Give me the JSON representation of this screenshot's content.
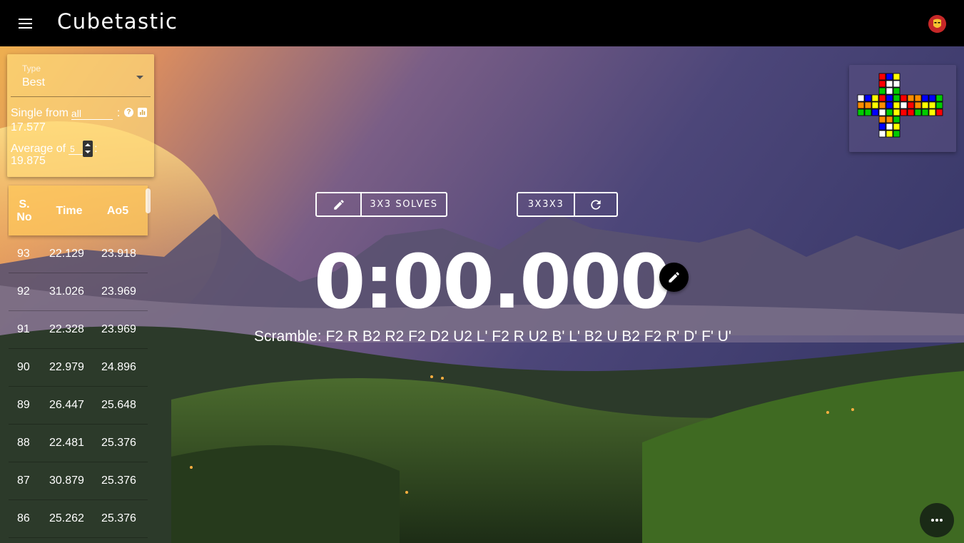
{
  "app": {
    "title": "Cubetastic"
  },
  "stats": {
    "type_label": "Type",
    "type_value": "Best",
    "single_label": "Single from",
    "single_scope": "all",
    "colon": ":",
    "single_value": "17.577",
    "avg_label": "Average of",
    "avg_count": "5",
    "avg_value": "19.875"
  },
  "table": {
    "headers": [
      "S. No",
      "Time",
      "Ao5"
    ],
    "rows": [
      {
        "sno": "93",
        "time": "22.129",
        "ao5": "23.918"
      },
      {
        "sno": "92",
        "time": "31.026",
        "ao5": "23.969"
      },
      {
        "sno": "91",
        "time": "22.328",
        "ao5": "23.969"
      },
      {
        "sno": "90",
        "time": "22.979",
        "ao5": "24.896"
      },
      {
        "sno": "89",
        "time": "26.447",
        "ao5": "25.648"
      },
      {
        "sno": "88",
        "time": "22.481",
        "ao5": "25.376"
      },
      {
        "sno": "87",
        "time": "30.879",
        "ao5": "25.376"
      },
      {
        "sno": "86",
        "time": "25.262",
        "ao5": "25.376"
      }
    ]
  },
  "controls": {
    "session_label": "3X3 SOLVES",
    "puzzle_label": "3X3X3"
  },
  "timer": {
    "display": "0:00.000"
  },
  "scramble": {
    "label": "Scramble:",
    "moves": "F2 R B2 R2 F2 D2 U2 L' F2 R U2 B' L' B2 U B2 F2 R' D' F' U'"
  },
  "cube_net": {
    "colors": {
      "W": "#ffffff",
      "Y": "#ffff00",
      "R": "#ff0000",
      "O": "#ff8c00",
      "B": "#0000ff",
      "G": "#00cc00"
    },
    "U": [
      [
        "R",
        "B",
        "Y"
      ],
      [
        "R",
        "W",
        "W"
      ],
      [
        "G",
        "W",
        "G"
      ]
    ],
    "L": [
      [
        "W",
        "B",
        "Y"
      ],
      [
        "O",
        "O",
        "Y"
      ],
      [
        "G",
        "G",
        "B"
      ]
    ],
    "F": [
      [
        "R",
        "B",
        "G"
      ],
      [
        "O",
        "B",
        "Y"
      ],
      [
        "W",
        "G",
        "Y"
      ]
    ],
    "R": [
      [
        "R",
        "O",
        "O"
      ],
      [
        "W",
        "R",
        "O"
      ],
      [
        "R",
        "R",
        "G"
      ]
    ],
    "B": [
      [
        "B",
        "B",
        "G"
      ],
      [
        "Y",
        "Y",
        "G"
      ],
      [
        "G",
        "Y",
        "R"
      ]
    ],
    "D": [
      [
        "O",
        "O",
        "G"
      ],
      [
        "B",
        "W",
        "Y"
      ],
      [
        "W",
        "Y",
        "G"
      ]
    ]
  },
  "icons": {
    "menu": "menu-icon",
    "avatar": "iron-man-avatar",
    "edit": "pencil-icon",
    "refresh": "refresh-icon",
    "help": "help-circle-icon",
    "chart": "chart-icon",
    "more": "more-horiz-icon",
    "dropdown": "chevron-down-icon"
  }
}
